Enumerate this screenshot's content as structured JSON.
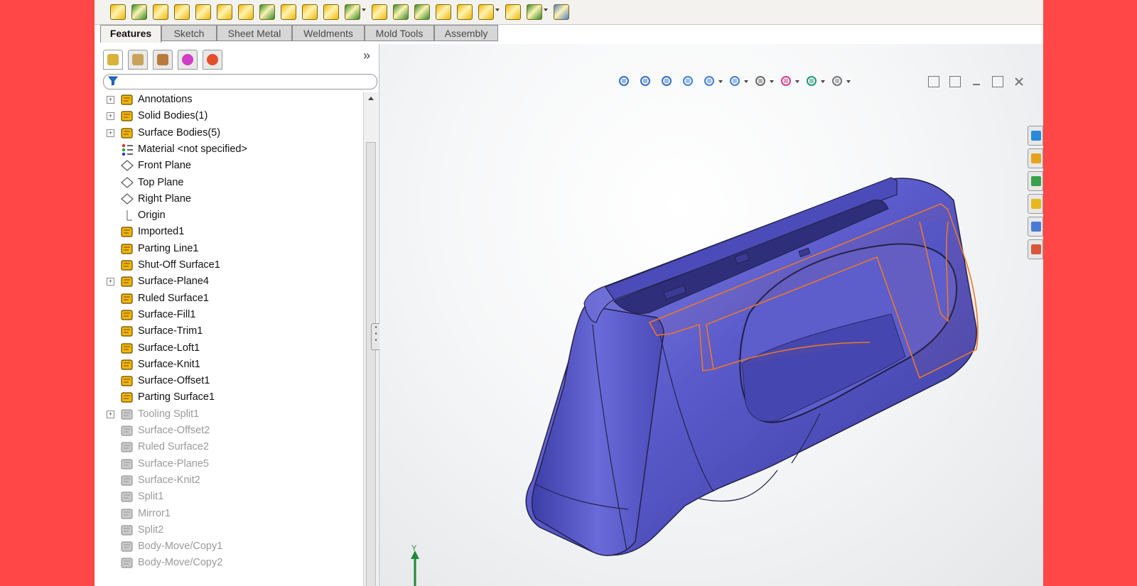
{
  "toolbar": {
    "icons": [
      "shut-off-surface-icon",
      "move-face-icon",
      "ruled-surface-icon",
      "surface-fill-icon",
      "parting-line-icon",
      "tooling-split-icon",
      "core-icon",
      "insert-mold-folders-icon",
      "draft-analysis-icon",
      "undercut-analysis-icon",
      "parting-surface-icon",
      "linear-pattern-icon",
      "extruded-boss-icon",
      "revolved-boss-icon",
      "swept-boss-icon",
      "lofted-boss-icon",
      "extruded-cut-icon",
      "fillet-icon",
      "reference-geometry-icon",
      "curves-icon",
      "instant3d-icon"
    ],
    "colors": {
      "primary": "#f2b705",
      "accent": "#2e8b2e"
    }
  },
  "tabs": [
    {
      "label": "Features",
      "active": true
    },
    {
      "label": "Sketch",
      "active": false
    },
    {
      "label": "Sheet Metal",
      "active": false
    },
    {
      "label": "Weldments",
      "active": false
    },
    {
      "label": "Mold Tools",
      "active": false
    },
    {
      "label": "Assembly",
      "active": false
    }
  ],
  "feature_manager": {
    "panel_tabs": [
      "feature-manager-tab-icon",
      "property-manager-tab-icon",
      "configuration-manager-tab-icon",
      "dimxpert-manager-tab-icon",
      "display-manager-tab-icon"
    ],
    "expand_glyph": "»",
    "filter_icon": "filter-icon",
    "items": [
      {
        "label": "Annotations",
        "icon": "annotations-icon",
        "expandable": true,
        "suppressed": false
      },
      {
        "label": "Solid Bodies(1)",
        "icon": "solid-bodies-icon",
        "expandable": true,
        "suppressed": false
      },
      {
        "label": "Surface Bodies(5)",
        "icon": "surface-bodies-icon",
        "expandable": true,
        "suppressed": false
      },
      {
        "label": "Material <not specified>",
        "icon": "material-icon",
        "expandable": false,
        "suppressed": false
      },
      {
        "label": "Front Plane",
        "icon": "plane-icon",
        "expandable": false,
        "suppressed": false
      },
      {
        "label": "Top Plane",
        "icon": "plane-icon",
        "expandable": false,
        "suppressed": false
      },
      {
        "label": "Right Plane",
        "icon": "plane-icon",
        "expandable": false,
        "suppressed": false
      },
      {
        "label": "Origin",
        "icon": "origin-icon",
        "expandable": false,
        "suppressed": false
      },
      {
        "label": "Imported1",
        "icon": "imported-body-icon",
        "expandable": false,
        "suppressed": false
      },
      {
        "label": "Parting Line1",
        "icon": "parting-line-icon",
        "expandable": false,
        "suppressed": false
      },
      {
        "label": "Shut-Off Surface1",
        "icon": "shut-off-surface-icon",
        "expandable": false,
        "suppressed": false
      },
      {
        "label": "Surface-Plane4",
        "icon": "surface-plane-icon",
        "expandable": true,
        "suppressed": false
      },
      {
        "label": "Ruled Surface1",
        "icon": "ruled-surface-icon",
        "expandable": false,
        "suppressed": false
      },
      {
        "label": "Surface-Fill1",
        "icon": "surface-fill-icon",
        "expandable": false,
        "suppressed": false
      },
      {
        "label": "Surface-Trim1",
        "icon": "surface-trim-icon",
        "expandable": false,
        "suppressed": false
      },
      {
        "label": "Surface-Loft1",
        "icon": "surface-loft-icon",
        "expandable": false,
        "suppressed": false
      },
      {
        "label": "Surface-Knit1",
        "icon": "surface-knit-icon",
        "expandable": false,
        "suppressed": false
      },
      {
        "label": "Surface-Offset1",
        "icon": "surface-offset-icon",
        "expandable": false,
        "suppressed": false
      },
      {
        "label": "Parting Surface1",
        "icon": "parting-surface-icon",
        "expandable": false,
        "suppressed": false
      },
      {
        "label": "Tooling Split1",
        "icon": "tooling-split-icon",
        "expandable": true,
        "suppressed": true
      },
      {
        "label": "Surface-Offset2",
        "icon": "surface-offset-icon",
        "expandable": false,
        "suppressed": true
      },
      {
        "label": "Ruled Surface2",
        "icon": "ruled-surface-icon",
        "expandable": false,
        "suppressed": true
      },
      {
        "label": "Surface-Plane5",
        "icon": "surface-plane-icon",
        "expandable": false,
        "suppressed": true
      },
      {
        "label": "Surface-Knit2",
        "icon": "surface-knit-icon",
        "expandable": false,
        "suppressed": true
      },
      {
        "label": "Split1",
        "icon": "split-icon",
        "expandable": false,
        "suppressed": true
      },
      {
        "label": "Mirror1",
        "icon": "mirror-icon",
        "expandable": false,
        "suppressed": true
      },
      {
        "label": "Split2",
        "icon": "split-icon",
        "expandable": false,
        "suppressed": true
      },
      {
        "label": "Body-Move/Copy1",
        "icon": "body-move-copy-icon",
        "expandable": false,
        "suppressed": true
      },
      {
        "label": "Body-Move/Copy2",
        "icon": "body-move-copy-icon",
        "expandable": false,
        "suppressed": true
      }
    ]
  },
  "heads_up_toolbar": {
    "icons": [
      "zoom-to-fit-icon",
      "zoom-to-area-icon",
      "previous-view-icon",
      "section-view-icon",
      "view-orientation-icon",
      "display-style-icon",
      "hide-show-items-icon",
      "edit-appearance-icon",
      "apply-scene-icon",
      "view-settings-icon"
    ]
  },
  "window_controls": [
    "tile-horizontal-icon",
    "tile-vertical-icon",
    "minimize-icon",
    "restore-icon",
    "close-icon"
  ],
  "task_pane": [
    "solidworks-resources-icon",
    "design-library-icon",
    "file-explorer-icon",
    "view-palette-icon",
    "appearances-icon",
    "custom-properties-icon"
  ],
  "model": {
    "body_color": "#5a5acb",
    "edge_color": "#2a2a55",
    "parting_line_color": "#e8782b"
  },
  "triad": {
    "axis_label": "Y"
  }
}
